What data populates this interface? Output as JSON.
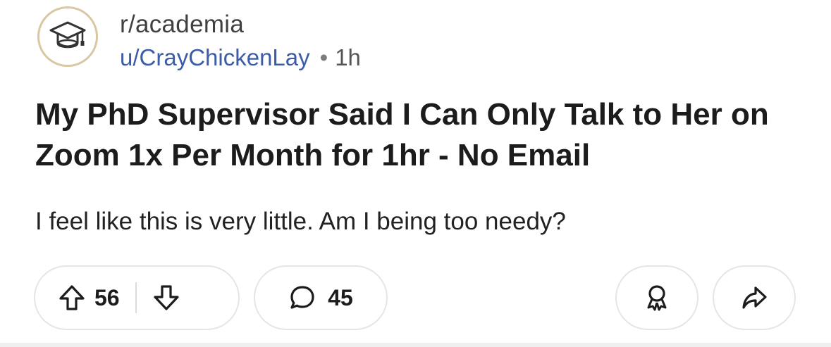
{
  "post": {
    "subreddit": "r/academia",
    "author": "u/CrayChickenLay",
    "separator": "•",
    "age": "1h",
    "title": "My PhD Supervisor Said I Can Only Talk to Her on Zoom 1x Per Month for 1hr - No Email",
    "body": "I feel like this is very little. Am I being too needy?"
  },
  "actions": {
    "upvote_count": "56",
    "comment_count": "45"
  },
  "icons": {
    "avatar": "graduation-cap-icon",
    "upvote": "arrow-up-icon",
    "downvote": "arrow-down-icon",
    "comment": "speech-bubble-icon",
    "award": "award-icon",
    "share": "share-arrow-icon"
  },
  "colors": {
    "username": "#3c5ba9",
    "avatar_ring": "#d9c7a3",
    "pill_border": "#e3e5e8"
  }
}
